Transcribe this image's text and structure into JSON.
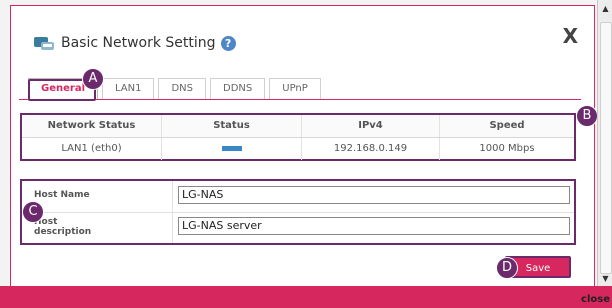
{
  "dialog": {
    "title": "Basic Network Setting",
    "help_glyph": "?",
    "close_glyph": "X"
  },
  "tabs": [
    {
      "label": "General",
      "active": true
    },
    {
      "label": "LAN1",
      "active": false
    },
    {
      "label": "DNS",
      "active": false
    },
    {
      "label": "DDNS",
      "active": false
    },
    {
      "label": "UPnP",
      "active": false
    }
  ],
  "status_table": {
    "headers": [
      "Network Status",
      "Status",
      "IPv4",
      "Speed"
    ],
    "row": {
      "network": "LAN1 (eth0)",
      "ipv4": "192.168.0.149",
      "speed": "1000 Mbps"
    }
  },
  "host": {
    "name_label": "Host Name",
    "name_value": "LG-NAS",
    "desc_label": "Host description",
    "desc_value": "LG-NAS server"
  },
  "save_label": "Save",
  "callouts": {
    "a": "A",
    "b": "B",
    "c": "C",
    "d": "D"
  },
  "page_close_text": "close",
  "colors": {
    "accent": "#d6275f",
    "callout": "#6b2a6b",
    "status": "#3a87c8"
  }
}
